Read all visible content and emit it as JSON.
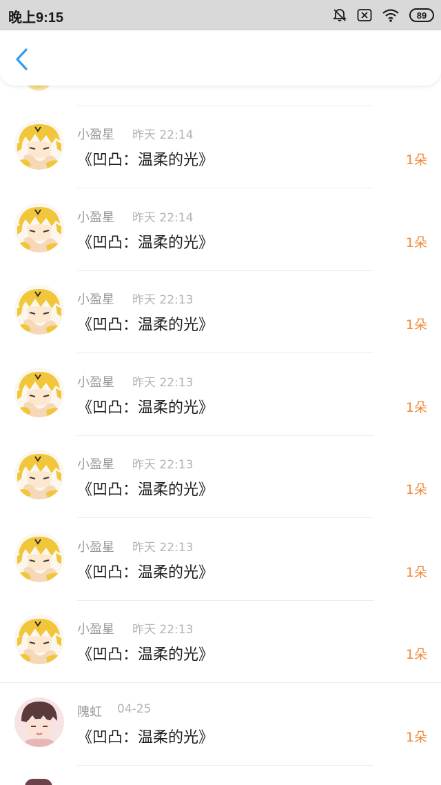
{
  "status_bar": {
    "time": "晚上9:15",
    "battery": "89",
    "icons": [
      "mute-bell-icon",
      "sim-x-icon",
      "wifi-icon",
      "battery-icon"
    ]
  },
  "header": {
    "back_icon": "chevron-left-icon",
    "accent_color": "#2f9bf0"
  },
  "colors": {
    "amount": "#f08a3c",
    "sender": "#9a9a9a",
    "time": "#b3b3b3"
  },
  "items": [
    {
      "sender": "小盈星",
      "time": "昨天 22:14",
      "title": "《凹凸：温柔的光》",
      "amount": "1朵",
      "avatar": "yellow-anime-avatar"
    },
    {
      "sender": "小盈星",
      "time": "昨天 22:14",
      "title": "《凹凸：温柔的光》",
      "amount": "1朵",
      "avatar": "yellow-anime-avatar"
    },
    {
      "sender": "小盈星",
      "time": "昨天 22:13",
      "title": "《凹凸：温柔的光》",
      "amount": "1朵",
      "avatar": "yellow-anime-avatar"
    },
    {
      "sender": "小盈星",
      "time": "昨天 22:13",
      "title": "《凹凸：温柔的光》",
      "amount": "1朵",
      "avatar": "yellow-anime-avatar"
    },
    {
      "sender": "小盈星",
      "time": "昨天 22:13",
      "title": "《凹凸：温柔的光》",
      "amount": "1朵",
      "avatar": "yellow-anime-avatar"
    },
    {
      "sender": "小盈星",
      "time": "昨天 22:13",
      "title": "《凹凸：温柔的光》",
      "amount": "1朵",
      "avatar": "yellow-anime-avatar"
    },
    {
      "sender": "小盈星",
      "time": "昨天 22:13",
      "title": "《凹凸：温柔的光》",
      "amount": "1朵",
      "avatar": "yellow-anime-avatar"
    },
    {
      "sender": "隗虹",
      "time": "04-25",
      "title": "《凹凸：温柔的光》",
      "amount": "1朵",
      "avatar": "brown-hair-anime-avatar"
    }
  ]
}
